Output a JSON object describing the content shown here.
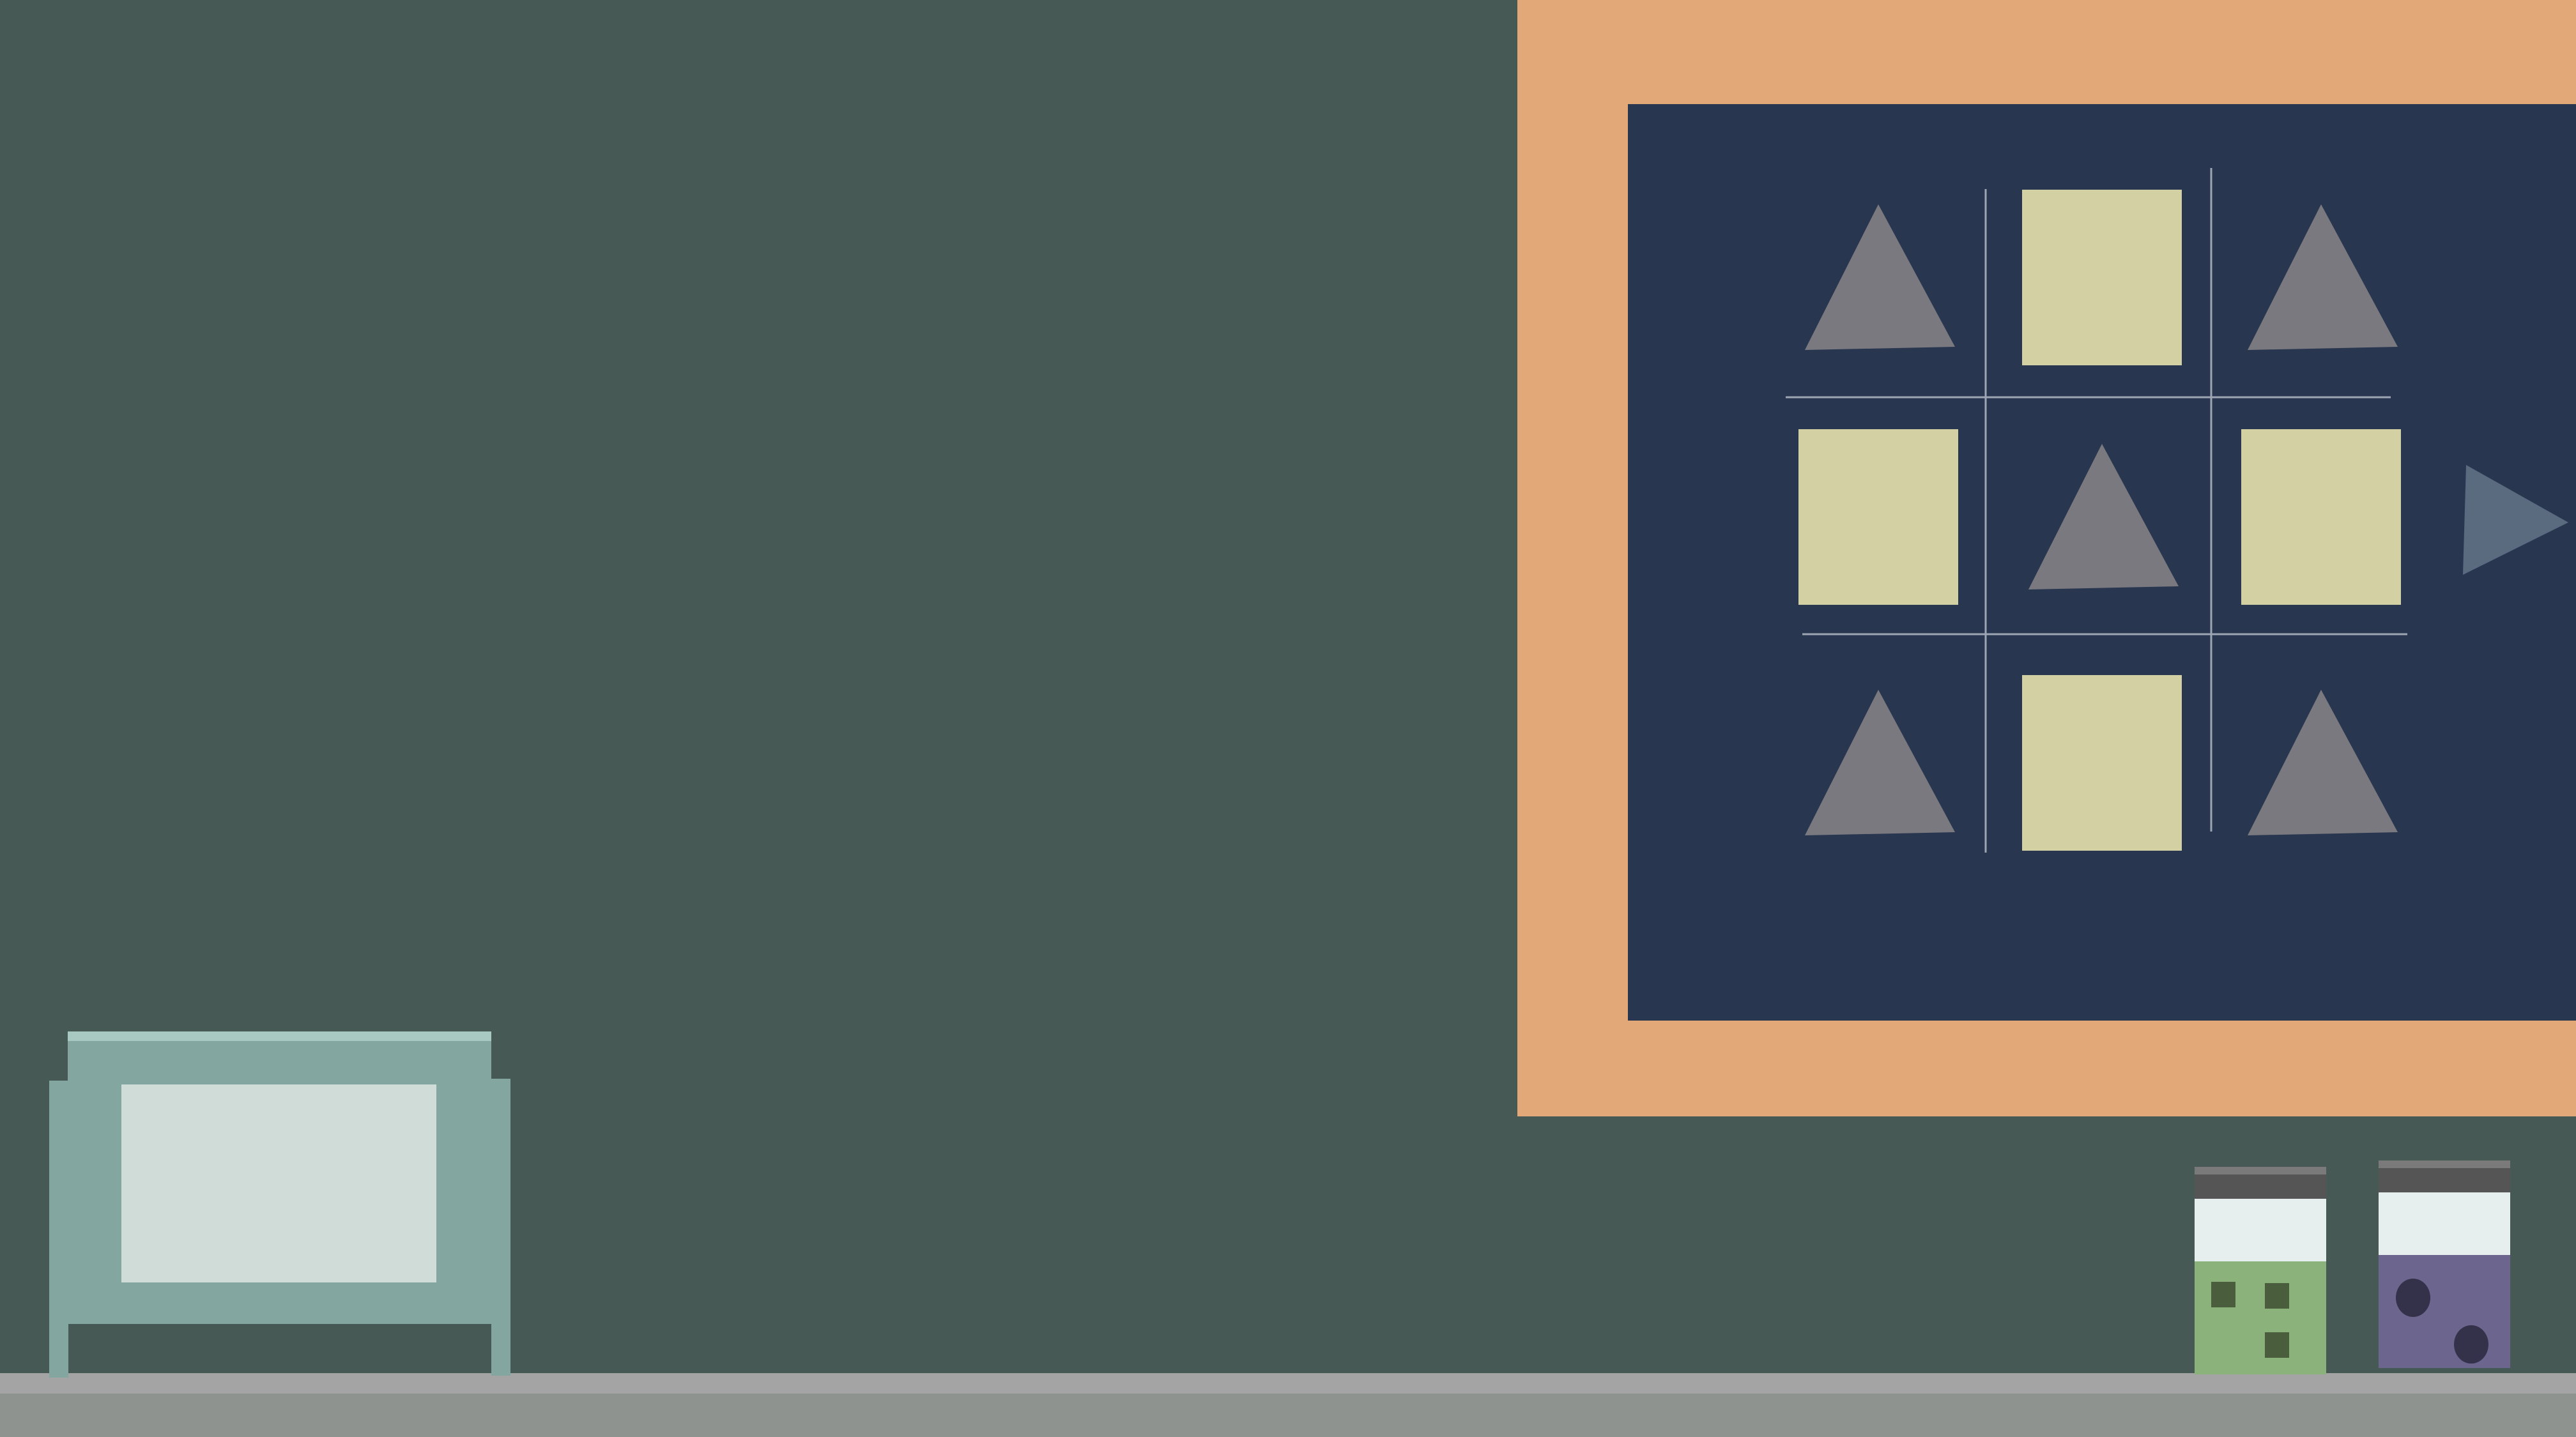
{
  "scene": {
    "kind": "puzzle-room",
    "colors": {
      "wall": "#475954",
      "floor_top": "#a4a4a4",
      "floor": "#8e9390",
      "board_frame": "#e3a878",
      "board_surface": "#293650",
      "grid_lines": "#9ea6b4",
      "triangle_tile": "#7a797f",
      "square_tile": "#d3d0a4",
      "next_arrow": "#5a6a7f",
      "cabinet_body": "#84a6a0",
      "cabinet_panel": "#cfdcd8",
      "cabinet_top": "#a8c8c2",
      "jar_lid": "#555555",
      "jar_glass": "#e6efee",
      "jar_green_fill": "#8bb27a",
      "jar_green_marks": "#4a5e3e",
      "jar_purple_fill": "#6c668e",
      "jar_purple_marks": "#34324a"
    }
  },
  "board": {
    "grid": [
      [
        "triangle",
        "square",
        "triangle"
      ],
      [
        "square",
        "triangle",
        "square"
      ],
      [
        "triangle",
        "square",
        "triangle"
      ]
    ],
    "next_arrow_icon": "triangle-right-icon"
  },
  "cabinet": {
    "icon": "cabinet-icon"
  },
  "jars": [
    {
      "id": "green",
      "mark_shape": "square",
      "mark_count": 3,
      "icon": "jar-icon"
    },
    {
      "id": "purple",
      "mark_shape": "circle",
      "mark_count": 2,
      "icon": "jar-icon"
    }
  ]
}
